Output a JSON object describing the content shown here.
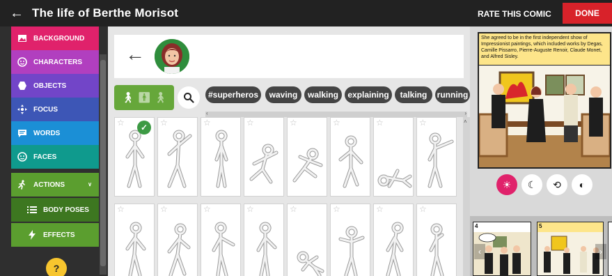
{
  "header": {
    "title": "The life of Berthe Morisot",
    "rate_label": "RATE THIS COMIC",
    "done_label": "DONE"
  },
  "sidebar": {
    "items": [
      {
        "label": "BACKGROUND",
        "color": "#e0226b",
        "icon": "image-icon"
      },
      {
        "label": "CHARACTERS",
        "color": "#b13fbf",
        "icon": "face-icon"
      },
      {
        "label": "OBJECTS",
        "color": "#7245c8",
        "icon": "hexagon-icon"
      },
      {
        "label": "FOCUS",
        "color": "#3d56b6",
        "icon": "focus-icon"
      },
      {
        "label": "WORDS",
        "color": "#1b8fd6",
        "icon": "speech-bubble-icon"
      },
      {
        "label": "FACES",
        "color": "#0f9a8d",
        "icon": "smiley-icon"
      },
      {
        "label": "ACTIONS",
        "color": "#5b9e2f",
        "icon": "running-figure-icon"
      },
      {
        "label": "BODY POSES",
        "color": "#3d7720",
        "icon": "list-icon"
      },
      {
        "label": "EFFECTS",
        "color": "#5b9e2f",
        "icon": "lightning-icon"
      }
    ],
    "help_label": "?"
  },
  "tags": [
    "#superheros",
    "waving",
    "walking",
    "explaining",
    "talking",
    "running"
  ],
  "comic": {
    "caption": "She agreed to be in the first independent show of Impressionist paintings, which included works by Degas, Camille Pissarro, Pierre-Auguste Renoir, Claude Monet, and Alfred Sisley.",
    "tools": [
      {
        "icon": "brightness-icon",
        "active": true
      },
      {
        "icon": "moon-icon",
        "active": false
      },
      {
        "icon": "history-icon",
        "active": false
      },
      {
        "icon": "palette-icon",
        "active": false
      }
    ],
    "thumb_numbers": [
      "4",
      "5"
    ]
  },
  "colors": {
    "topbar": "#222222",
    "done": "#d8222a",
    "accent_pink": "#e0226b",
    "pose_toggle": "#66a73a"
  }
}
